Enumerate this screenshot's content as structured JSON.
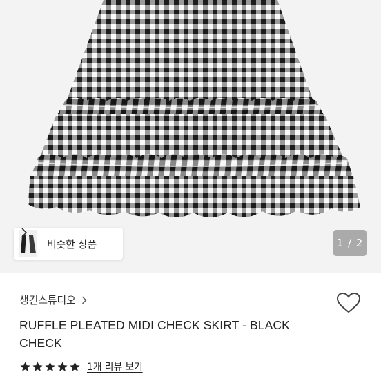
{
  "product_image": {
    "alt_icon": "checked-skirt-image"
  },
  "similar": {
    "label": "비슷한 상품",
    "icon": "chevron-right-icon"
  },
  "pager": {
    "current": "1",
    "total": "2",
    "text": "1 / 2"
  },
  "brand": {
    "name": "생긴스튜디오",
    "icon": "chevron-right-icon"
  },
  "like": {
    "icon": "heart-icon"
  },
  "product": {
    "title": "RUFFLE PLEATED MIDI CHECK SKIRT - BLACK CHECK"
  },
  "rating": {
    "stars": 5,
    "max": 5,
    "review_text": "1개 리뷰 보기"
  },
  "colors": {
    "accent": "#222222",
    "star": "#222222"
  }
}
